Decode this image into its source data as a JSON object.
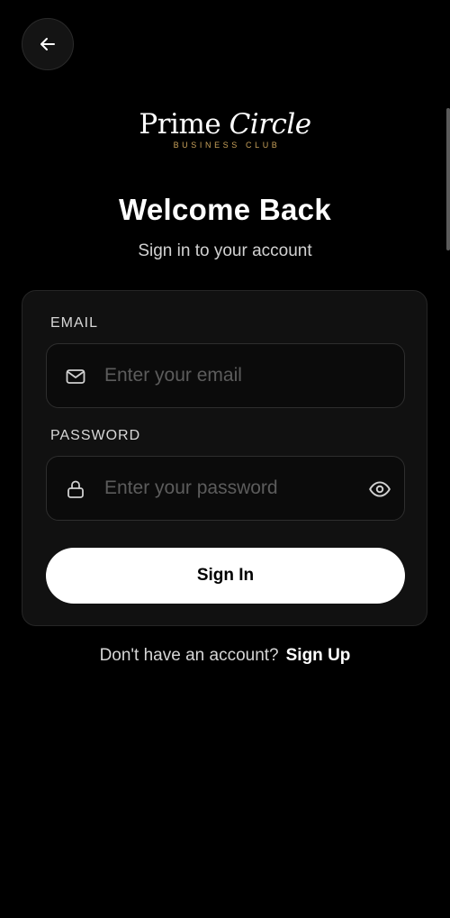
{
  "header": {
    "back_icon": "arrow-left-icon"
  },
  "logo": {
    "word1": "Prime",
    "word2": "Circle",
    "tagline": "BUSINESS CLUB",
    "tagline_color": "#c8a15a"
  },
  "title": "Welcome Back",
  "subtitle": "Sign in to your account",
  "form": {
    "email": {
      "label": "EMAIL",
      "value": "",
      "placeholder": "Enter your email",
      "icon": "mail-icon"
    },
    "password": {
      "label": "PASSWORD",
      "value": "",
      "placeholder": "Enter your password",
      "icon": "lock-icon",
      "toggle_icon": "eye-icon"
    },
    "submit_label": "Sign In"
  },
  "footer": {
    "prompt": "Don't have an account?",
    "link_label": "Sign Up"
  },
  "colors": {
    "background": "#000000",
    "card": "#111111",
    "accent": "#c8a15a",
    "button": "#ffffff"
  }
}
